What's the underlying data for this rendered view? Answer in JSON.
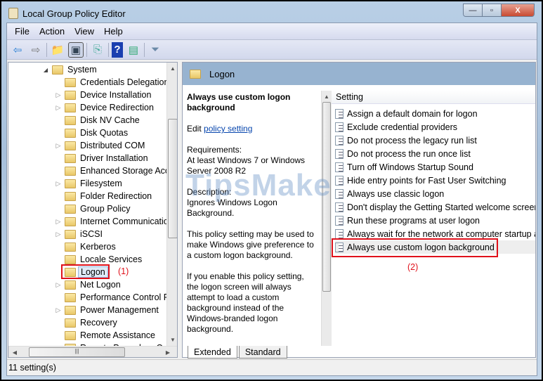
{
  "window": {
    "title": "Local Group Policy Editor",
    "minimize": "—",
    "maximize": "▫",
    "close": "X"
  },
  "menu": [
    "File",
    "Action",
    "View",
    "Help"
  ],
  "toolbar": [
    {
      "icon": "back-icon",
      "g": "⇦"
    },
    {
      "icon": "forward-icon",
      "g": "⇨"
    },
    {
      "icon": "up-folder-icon",
      "g": "📁"
    },
    {
      "icon": "show-hide-tree-icon",
      "g": "▣"
    },
    {
      "icon": "export-list-icon",
      "g": "⎘"
    },
    {
      "icon": "help-icon",
      "g": "?"
    },
    {
      "icon": "show-action-pane-icon",
      "g": "▤"
    },
    {
      "icon": "filter-icon",
      "g": "⏷"
    }
  ],
  "tree": {
    "root": "System",
    "items": [
      {
        "label": "Credentials Delegation",
        "exp": false
      },
      {
        "label": "Device Installation",
        "exp": true
      },
      {
        "label": "Device Redirection",
        "exp": true
      },
      {
        "label": "Disk NV Cache",
        "exp": false
      },
      {
        "label": "Disk Quotas",
        "exp": false
      },
      {
        "label": "Distributed COM",
        "exp": true
      },
      {
        "label": "Driver Installation",
        "exp": false
      },
      {
        "label": "Enhanced Storage Acce",
        "exp": false
      },
      {
        "label": "Filesystem",
        "exp": true
      },
      {
        "label": "Folder Redirection",
        "exp": false
      },
      {
        "label": "Group Policy",
        "exp": false
      },
      {
        "label": "Internet Communicatio",
        "exp": true
      },
      {
        "label": "iSCSI",
        "exp": true
      },
      {
        "label": "Kerberos",
        "exp": false
      },
      {
        "label": "Locale Services",
        "exp": false
      },
      {
        "label": "Logon",
        "exp": false,
        "selected": true
      },
      {
        "label": "Net Logon",
        "exp": true
      },
      {
        "label": "Performance Control Pa",
        "exp": false
      },
      {
        "label": "Power Management",
        "exp": true
      },
      {
        "label": "Recovery",
        "exp": false
      },
      {
        "label": "Remote Assistance",
        "exp": false
      },
      {
        "label": "Remote Procedure Call",
        "exp": false
      }
    ],
    "annotation": "(1)"
  },
  "pane": {
    "header": "Logon",
    "title": "Always use custom logon background",
    "edit_prefix": "Edit ",
    "edit_link": "policy setting",
    "requirements": "Requirements:\nAt least Windows 7 or Windows Server 2008 R2",
    "description": "Description:\nIgnores Windows Logon Background.",
    "p1": "This policy setting may be used to make Windows give preference to a custom logon background.",
    "p2": "If you enable this policy setting, the logon screen will always attempt to load a custom background instead of the Windows-branded logon background."
  },
  "list": {
    "column": "Setting",
    "items": [
      "Assign a default domain for logon",
      "Exclude credential providers",
      "Do not process the legacy run list",
      "Do not process the run once list",
      "Turn off Windows Startup Sound",
      "Hide entry points for Fast User Switching",
      "Always use classic logon",
      "Don't display the Getting Started welcome screen at logon",
      "Run these programs at user logon",
      "Always wait for the network at computer startup and logon",
      "Always use custom logon background"
    ],
    "highlighted": 10,
    "annotation": "(2)"
  },
  "tabs": [
    "Extended",
    "Standard"
  ],
  "status": "11 setting(s)",
  "watermark": "TipsMake"
}
